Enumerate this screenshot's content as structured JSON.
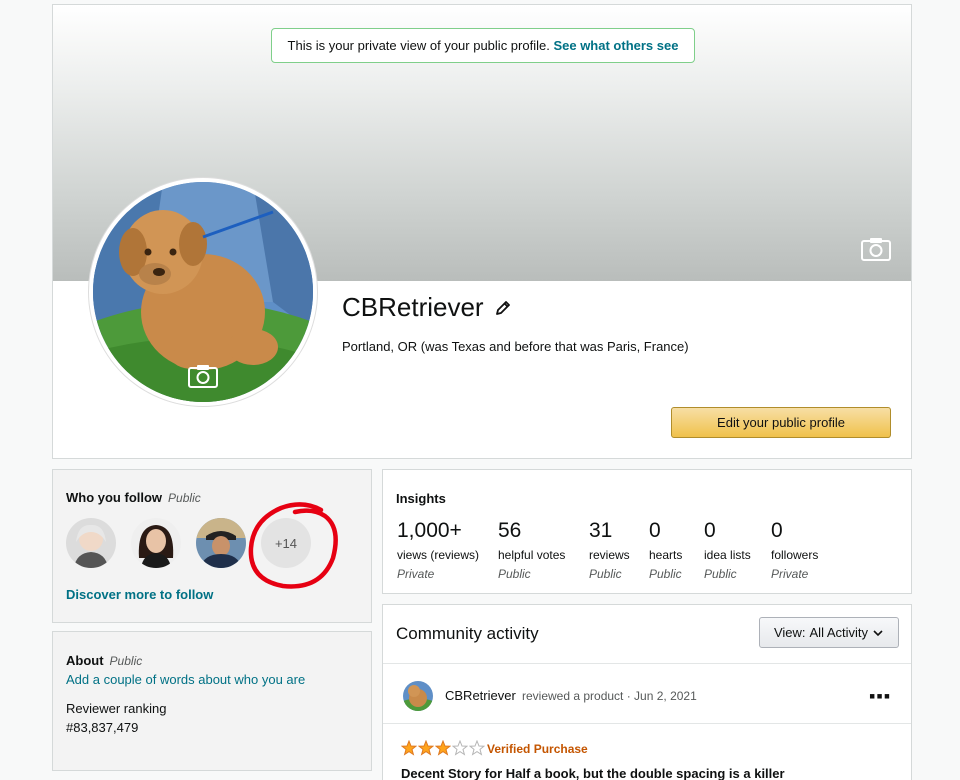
{
  "banner": {
    "notice_text": "This is your private view of your public profile.",
    "notice_link": "See what others see"
  },
  "profile": {
    "username": "CBRetriever",
    "location": "Portland, OR (was Texas and before that was Paris, France)",
    "edit_button": "Edit your public profile"
  },
  "follow": {
    "title": "Who you follow",
    "visibility": "Public",
    "more_count": "+14",
    "discover_link": "Discover more to follow"
  },
  "about": {
    "title": "About",
    "visibility": "Public",
    "add_link": "Add a couple of words about who you are",
    "ranking_label": "Reviewer ranking",
    "ranking_value": "#83,837,479"
  },
  "insights": {
    "title": "Insights",
    "stats": [
      {
        "value": "1,000+",
        "label": "views (reviews)",
        "visibility": "Private"
      },
      {
        "value": "56",
        "label": "helpful votes",
        "visibility": "Public"
      },
      {
        "value": "31",
        "label": "reviews",
        "visibility": "Public"
      },
      {
        "value": "0",
        "label": "hearts",
        "visibility": "Public"
      },
      {
        "value": "0",
        "label": "idea lists",
        "visibility": "Public"
      },
      {
        "value": "0",
        "label": "followers",
        "visibility": "Private"
      }
    ]
  },
  "community": {
    "title": "Community activity",
    "view_label": "View:",
    "view_value": "All Activity",
    "activity": {
      "user": "CBRetriever",
      "description": "reviewed a product · Jun 2, 2021",
      "rating": 3,
      "rating_max": 5,
      "verified": "Verified Purchase",
      "review_title": "Decent Story for Half a book, but the double spacing is a killer"
    }
  },
  "colors": {
    "link": "#007185",
    "star": "#ffa41c",
    "verified": "#c45500",
    "button": "#f0c14b",
    "annotation": "#e60012"
  }
}
